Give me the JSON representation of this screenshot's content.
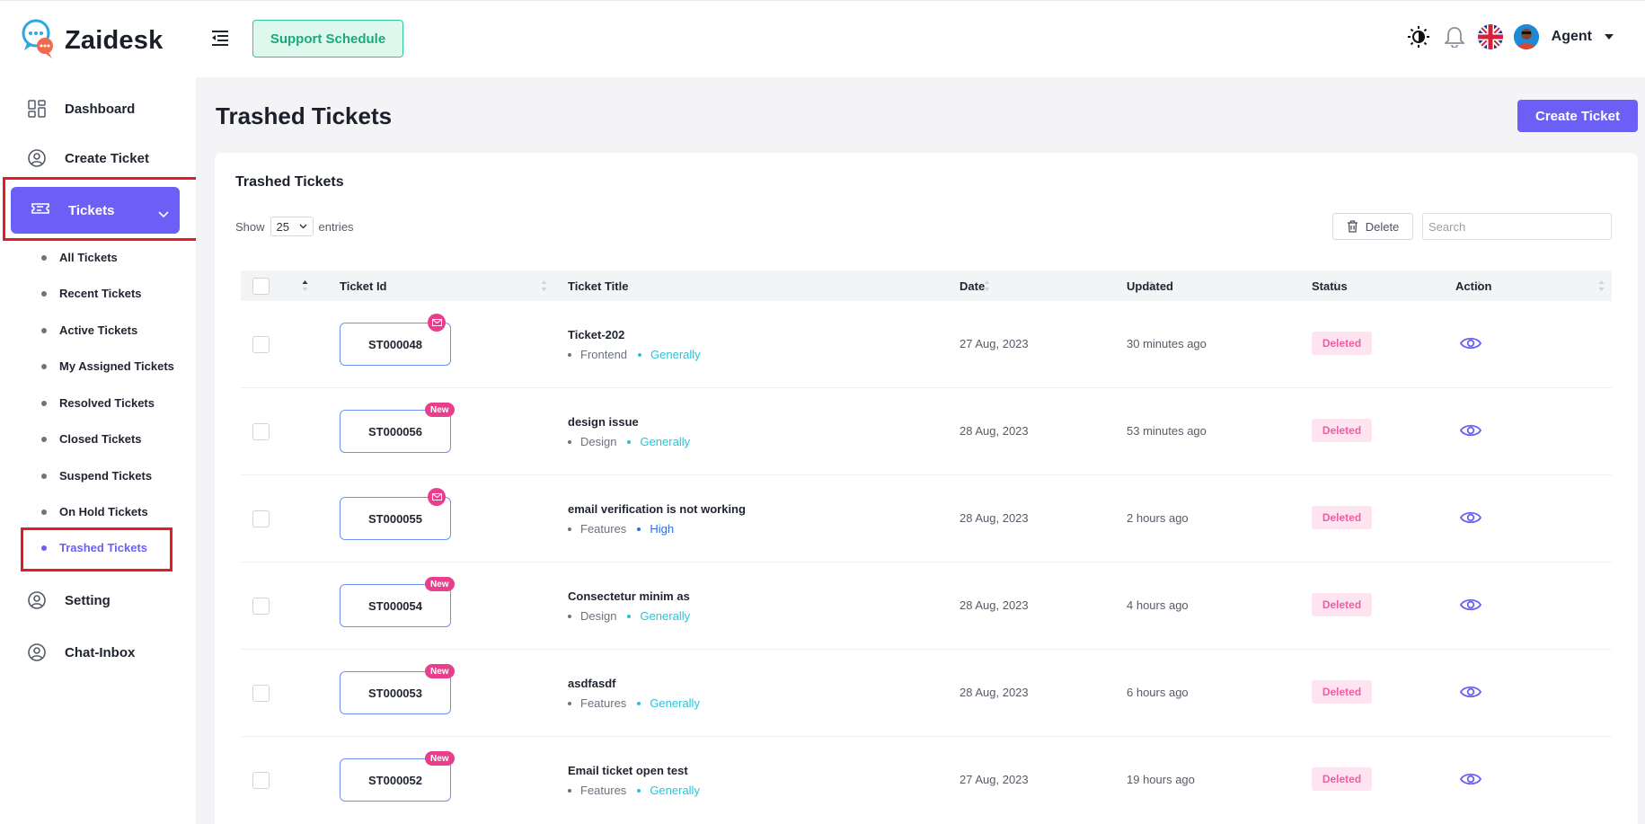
{
  "app": {
    "name": "Zaidesk"
  },
  "header": {
    "support_schedule_label": "Support Schedule",
    "user_name": "Agent",
    "icons": [
      "theme-toggle-icon",
      "notification-bell-icon",
      "uk-flag-icon",
      "user-avatar"
    ]
  },
  "sidebar": {
    "items": [
      {
        "label": "Dashboard",
        "icon": "dashboard-grid-icon"
      },
      {
        "label": "Create Ticket",
        "icon": "user-circle-icon"
      },
      {
        "label": "Tickets",
        "icon": "ticket-icon",
        "expanded": true
      },
      {
        "label": "Setting",
        "icon": "user-circle-icon"
      },
      {
        "label": "Chat-Inbox",
        "icon": "user-circle-icon"
      }
    ],
    "sub_items": [
      {
        "label": "All Tickets"
      },
      {
        "label": "Recent Tickets"
      },
      {
        "label": "Active Tickets"
      },
      {
        "label": "My Assigned Tickets"
      },
      {
        "label": "Resolved Tickets"
      },
      {
        "label": "Closed Tickets"
      },
      {
        "label": "Suspend Tickets"
      },
      {
        "label": "On Hold Tickets"
      },
      {
        "label": "Trashed Tickets",
        "active": true
      }
    ]
  },
  "main": {
    "page_title": "Trashed Tickets",
    "create_button": "Create Ticket",
    "card_title": "Trashed Tickets",
    "show_label": "Show",
    "entries_value": "25",
    "entries_label": "entries",
    "delete_label": "Delete",
    "search_placeholder": "Search",
    "columns": [
      "Ticket Id",
      "Ticket Title",
      "Date",
      "Updated",
      "Status",
      "Action"
    ],
    "rows": [
      {
        "id": "ST000048",
        "badge": "mail",
        "title": "Ticket-202",
        "category": "Frontend",
        "priority": "Generally",
        "date": "27 Aug, 2023",
        "updated": "30 minutes ago",
        "status": "Deleted"
      },
      {
        "id": "ST000056",
        "badge": "New",
        "title": "design issue",
        "category": "Design",
        "priority": "Generally",
        "date": "28 Aug, 2023",
        "updated": "53 minutes ago",
        "status": "Deleted"
      },
      {
        "id": "ST000055",
        "badge": "mail",
        "title": "email verification is not working",
        "category": "Features",
        "priority": "High",
        "date": "28 Aug, 2023",
        "updated": "2 hours ago",
        "status": "Deleted"
      },
      {
        "id": "ST000054",
        "badge": "New",
        "title": "Consectetur minim as",
        "category": "Design",
        "priority": "Generally",
        "date": "28 Aug, 2023",
        "updated": "4 hours ago",
        "status": "Deleted"
      },
      {
        "id": "ST000053",
        "badge": "New",
        "title": "asdfasdf",
        "category": "Features",
        "priority": "Generally",
        "date": "28 Aug, 2023",
        "updated": "6 hours ago",
        "status": "Deleted"
      },
      {
        "id": "ST000052",
        "badge": "New",
        "title": "Email ticket open test",
        "category": "Features",
        "priority": "Generally",
        "date": "27 Aug, 2023",
        "updated": "19 hours ago",
        "status": "Deleted"
      }
    ]
  },
  "colors": {
    "accent": "#6c5ff5",
    "support_green": "#2ec79a",
    "deleted_pink": "#f05da1",
    "badge_pink": "#e83e8c",
    "highlight_red": "#e41b23"
  }
}
